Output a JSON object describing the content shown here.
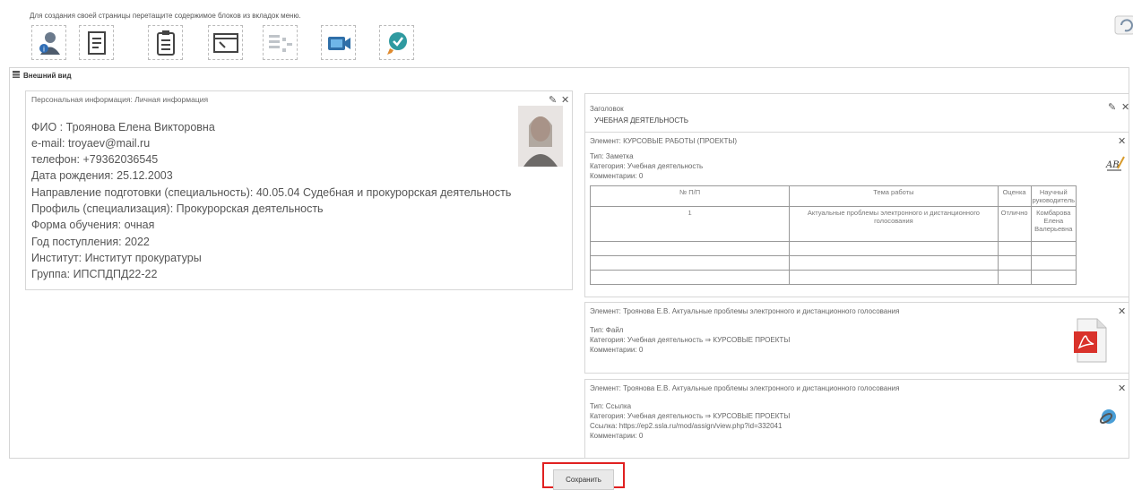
{
  "hint_text": "Для создания своей страницы перетащите содержимое блоков из вкладок меню.",
  "toolbar_icons": [
    "user-info-icon",
    "document-icon",
    "clipboard-icon",
    "window-icon",
    "table-icon",
    "video-icon",
    "achievement-icon"
  ],
  "view_title": "Внешний вид",
  "personal": {
    "title": "Персональная информация: Личная информация",
    "lines": [
      "ФИО : Троянова Елена Викторовна",
      "e-mail: troyaev@mail.ru",
      "телефон: +79362036545",
      "Дата рождения: 25.12.2003",
      "Направление подготовки (специальность): 40.05.04 Судебная и прокурорская деятельность",
      "Профиль (специализация): Прокурорская деятельность",
      "Форма обучения: очная",
      "Год поступления: 2022",
      "Институт: Институт прокуратуры",
      "Группа: ИПСПДПД22-22"
    ]
  },
  "heading_panel": {
    "label": "Заголовок",
    "value": "УЧЕБНАЯ ДЕЯТЕЛЬНОСТЬ"
  },
  "coursework": {
    "title": "Элемент: КУРСОВЫЕ РАБОТЫ (ПРОЕКТЫ)",
    "type": "Тип: Заметка",
    "category": "Категория: Учебная деятельность",
    "comments": "Комментарии: 0",
    "table": {
      "headers": [
        "№ П/П",
        "Тема работы",
        "Оценка",
        "Научный руководитель"
      ],
      "rows": [
        [
          "1",
          "Актуальные проблемы электронного и дистанционного голосования",
          "Отлично",
          "Комбарова Елена Валерьевна"
        ],
        [
          "",
          "",
          "",
          ""
        ],
        [
          "",
          "",
          "",
          ""
        ],
        [
          "",
          "",
          "",
          ""
        ]
      ]
    }
  },
  "file_panel": {
    "title": "Элемент: Троянова Е.В. Актуальные проблемы электронного и дистанционного голосования",
    "type": "Тип: Файл",
    "category": "Категория: Учебная деятельность ⇒ КУРСОВЫЕ ПРОЕКТЫ",
    "comments": "Комментарии: 0"
  },
  "link_panel": {
    "title": "Элемент: Троянова Е.В. Актуальные проблемы электронного и дистанционного голосования",
    "type": "Тип: Ссылка",
    "category": "Категория: Учебная деятельность ⇒ КУРСОВЫЕ ПРОЕКТЫ",
    "link": "Ссылка: https://ep2.ssla.ru/mod/assign/view.php?id=332041",
    "comments": "Комментарии: 0"
  },
  "controls": {
    "edit": "✎",
    "close": "✕"
  },
  "save_label": "Сохранить",
  "colors": {
    "highlight": "#e02020",
    "pdf_red": "#d9322b",
    "panel_border": "#d7d7d7"
  }
}
